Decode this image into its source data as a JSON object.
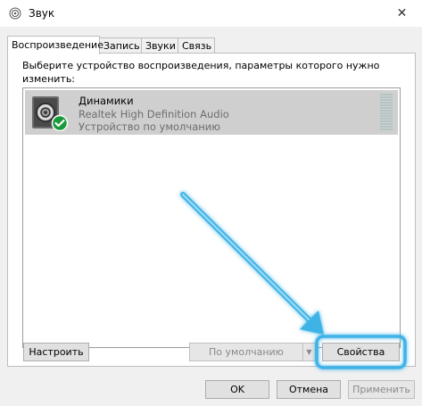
{
  "window": {
    "title": "Звук",
    "close_icon": "close-icon",
    "app_icon": "speaker-app-icon"
  },
  "tabs": [
    {
      "label": "Воспроизведение",
      "active": true
    },
    {
      "label": "Запись",
      "active": false
    },
    {
      "label": "Звуки",
      "active": false
    },
    {
      "label": "Связь",
      "active": false
    }
  ],
  "panel": {
    "instruction": "Выберите устройство воспроизведения, параметры которого нужно изменить:"
  },
  "devices": [
    {
      "name": "Динамики",
      "driver": "Realtek High Definition Audio",
      "status": "Устройство по умолчанию",
      "icon": "speaker-icon",
      "badge_icon": "check-icon",
      "selected": true
    }
  ],
  "buttons": {
    "configure": "Настроить",
    "set_default": "По умолчанию",
    "properties": "Свойства",
    "ok": "OK",
    "cancel": "Отмена",
    "apply": "Применить"
  },
  "colors": {
    "highlight": "#3fb3e6",
    "check_badge": "#1b9a3b",
    "selected_row": "#cfcfcf"
  }
}
